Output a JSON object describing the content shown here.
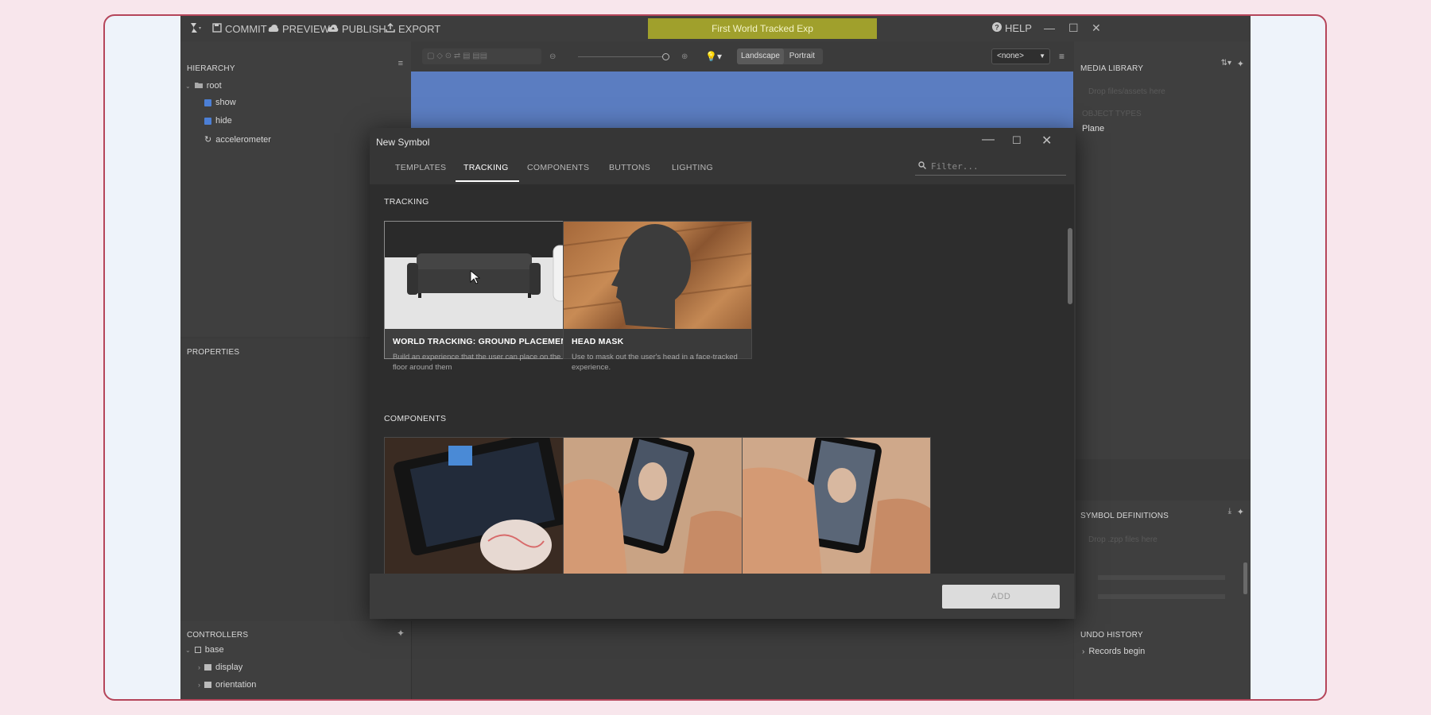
{
  "toolbar": {
    "commit": "COMMIT",
    "preview": "PREVIEW",
    "publish": "PUBLISH",
    "export": "EXPORT",
    "project_title": "First World Tracked Exp",
    "help": "HELP"
  },
  "hierarchy": {
    "header": "HIERARCHY",
    "items": [
      "root",
      "show",
      "hide",
      "accelerometer"
    ]
  },
  "properties": {
    "header": "PROPERTIES"
  },
  "controllers": {
    "header": "CONTROLLERS",
    "items": [
      "base",
      "display",
      "orientation"
    ]
  },
  "viewport": {
    "landscape": "Landscape",
    "portrait": "Portrait",
    "dropdown": "<none>"
  },
  "media_library": {
    "header": "MEDIA LIBRARY",
    "drop_hint": "Drop files/assets here",
    "object_types": "OBJECT TYPES",
    "plane": "Plane"
  },
  "symbol_definitions": {
    "header": "SYMBOL DEFINITIONS",
    "drop_hint": "Drop .zpp files here"
  },
  "undo_history": {
    "header": "UNDO HISTORY",
    "item": "Records begin"
  },
  "modal": {
    "title": "New Symbol",
    "tabs": [
      "TEMPLATES",
      "TRACKING",
      "COMPONENTS",
      "BUTTONS",
      "LIGHTING"
    ],
    "filter_placeholder": "Filter...",
    "section_tracking": "TRACKING",
    "section_components": "COMPONENTS",
    "cards": [
      {
        "title": "WORLD TRACKING: GROUND PLACEMENT",
        "desc": "Build an experience that the user can place on the floor around them"
      },
      {
        "title": "HEAD MASK",
        "desc": "Use to mask out the user's head in a face-tracked experience."
      }
    ],
    "add_button": "ADD"
  }
}
